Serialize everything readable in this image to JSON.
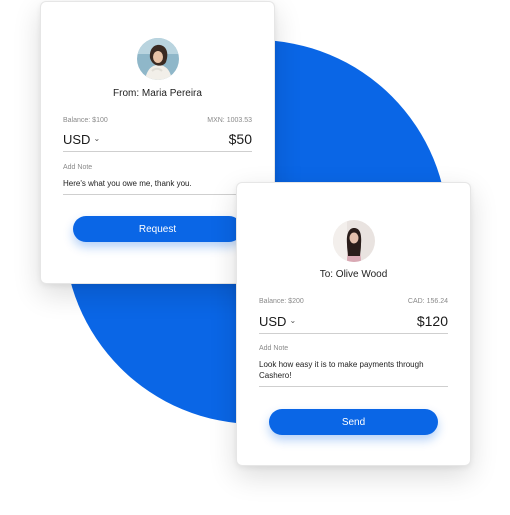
{
  "colors": {
    "accent": "#0a66e6",
    "card_bg": "#ffffff",
    "divider": "#cfcfcf"
  },
  "request_card": {
    "name": "From: Maria Pereira",
    "balance": "Balance: $100",
    "conversion": "MXN: 1003.53",
    "currency": "USD",
    "amount": "$50",
    "note_label": "Add Note",
    "note": "Here's what you owe me, thank you.",
    "button": "Request"
  },
  "send_card": {
    "name": "To: Olive Wood",
    "balance": "Balance: $200",
    "conversion": "CAD: 156.24",
    "currency": "USD",
    "amount": "$120",
    "note_label": "Add Note",
    "note": "Look how easy it is to make payments through Cashero!",
    "button": "Send"
  },
  "icons": {
    "dropdown": "chevron-down-icon"
  }
}
